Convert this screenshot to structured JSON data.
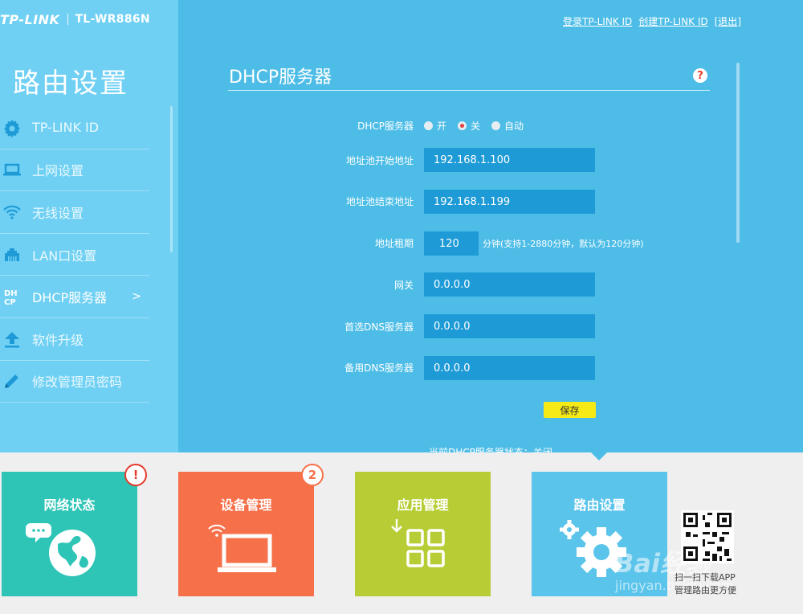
{
  "header": {
    "brand": "TP-LINK",
    "model": "TL-WR886N",
    "links": [
      "登录TP-LINK ID",
      "创建TP-LINK ID",
      "退出"
    ]
  },
  "sidebar": {
    "title": "路由设置",
    "items": [
      {
        "label": "TP-LINK ID",
        "icon": "gear-icon"
      },
      {
        "label": "上网设置",
        "icon": "laptop-icon"
      },
      {
        "label": "无线设置",
        "icon": "wifi-icon"
      },
      {
        "label": "LAN口设置",
        "icon": "ethernet-port-icon"
      },
      {
        "label": "DHCP服务器",
        "icon": "dhcp-icon",
        "arrow": ">"
      },
      {
        "label": "软件升级",
        "icon": "upload-icon"
      },
      {
        "label": "修改管理员密码",
        "icon": "pencil-icon"
      }
    ]
  },
  "panel": {
    "title": "DHCP服务器",
    "help": "?",
    "dhcp_label": "DHCP服务器",
    "radios": [
      {
        "label": "开",
        "checked": false
      },
      {
        "label": "关",
        "checked": true
      },
      {
        "label": "自动",
        "checked": false
      }
    ],
    "fields": {
      "pool_start": {
        "label": "地址池开始地址",
        "value": "192.168.1.100"
      },
      "pool_end": {
        "label": "地址池结束地址",
        "value": "192.168.1.199"
      },
      "lease": {
        "label": "地址租期",
        "value": "120",
        "hint": "分钟(支持1-2880分钟，默认为120分钟)"
      },
      "gateway": {
        "label": "网关",
        "value": "0.0.0.0"
      },
      "dns_primary": {
        "label": "首选DNS服务器",
        "value": "0.0.0.0"
      },
      "dns_secondary": {
        "label": "备用DNS服务器",
        "value": "0.0.0.0"
      }
    },
    "save_label": "保存",
    "status_text": "当前DHCP服务器状态：关闭"
  },
  "tiles": [
    {
      "label": "网络状态",
      "color": "#2ec4b6",
      "badge": "!",
      "badge_color": "#e53b2c"
    },
    {
      "label": "设备管理",
      "color": "#f6704a",
      "badge": "2",
      "badge_color": "#f6704a"
    },
    {
      "label": "应用管理",
      "color": "#b8cc35"
    },
    {
      "label": "路由设置",
      "color": "#5bc4eb"
    }
  ],
  "qr_caption": [
    "扫一扫下载APP",
    "管理路由更方便"
  ],
  "watermark": {
    "logo": "Bai经验",
    "url": "jingyan.baidu.com"
  },
  "colors": {
    "top_bg": "#4dbde7",
    "sidebar_bg": "#6fd0f3",
    "input_bg": "#1e9bd7",
    "save_btn": "#f5ea16"
  }
}
